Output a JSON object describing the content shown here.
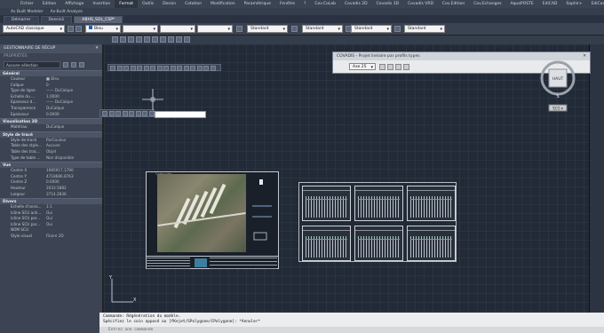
{
  "menubar": {
    "items": [
      "Fichier",
      "Edition",
      "Affichage",
      "Insertion",
      "Format",
      "Outils",
      "Dessin",
      "Cotation",
      "Modification",
      "Paramétrique",
      "Fenêtre",
      "?",
      "Cov.CoLab",
      "Covadis 2D",
      "Covadis 3D",
      "Covadis VRD",
      "Cov.Edition",
      "Cov.Echanges",
      "AquaPOSTE",
      "EdiCAD",
      "Saphir+",
      "EdiCad Light"
    ],
    "active_index": 4
  },
  "subrow": {
    "items": [
      "As Built Modeler",
      "As-Built Analyse"
    ]
  },
  "tabs": {
    "items": [
      "Démarrer",
      "Dessin1",
      "ABHS_SOL_CSP*"
    ],
    "active_index": 2
  },
  "toolbar": {
    "workspace": "AutoCAD classique",
    "color": "Bleu",
    "style1": "Standard",
    "style2": "Standard",
    "style3": "Standard",
    "style4": "Standard"
  },
  "palette": {
    "header": "GESTIONNAIRE DE RÉCUP",
    "close": "✕",
    "side_label": "PROPRIÉTÉS",
    "selection": "Aucune sélection",
    "sections": [
      {
        "title": "Général",
        "rows": [
          {
            "k": "Couleur",
            "v": "■ Bleu"
          },
          {
            "k": "Calque",
            "v": "0"
          },
          {
            "k": "Type de ligne",
            "v": "—— DuCalque"
          },
          {
            "k": "Echelle du ...",
            "v": "1.0000"
          },
          {
            "k": "Epaisseur d...",
            "v": "—— DuCalque"
          },
          {
            "k": "Transparence",
            "v": "DuCalque"
          },
          {
            "k": "Epaisseur",
            "v": "0.0000"
          }
        ]
      },
      {
        "title": "Visualisation 3D",
        "rows": [
          {
            "k": "Matériau",
            "v": "DuCalque"
          }
        ]
      },
      {
        "title": "Style de tracé",
        "rows": [
          {
            "k": "Style de tracé",
            "v": "ParCouleur"
          },
          {
            "k": "Table des style...",
            "v": "Aucune"
          },
          {
            "k": "Table des trac...",
            "v": "Objet"
          },
          {
            "k": "Type de table ...",
            "v": "Non disponible"
          }
        ]
      },
      {
        "title": "Vue",
        "rows": [
          {
            "k": "Centre X",
            "v": "1985917.1790"
          },
          {
            "k": "Centre Y",
            "v": "4718686.8763"
          },
          {
            "k": "Centre Z",
            "v": "0.0000"
          },
          {
            "k": "Hauteur",
            "v": "2033.5882"
          },
          {
            "k": "Largeur",
            "v": "3714.2836"
          }
        ]
      },
      {
        "title": "Divers",
        "rows": [
          {
            "k": "Echelle d'anno...",
            "v": "1:1"
          },
          {
            "k": "Icône SCU acti...",
            "v": "Oui"
          },
          {
            "k": "Icône SCU par...",
            "v": "Oui"
          },
          {
            "k": "Icône SCU par...",
            "v": "Oui"
          },
          {
            "k": "NOM SCU",
            "v": ""
          },
          {
            "k": "Style visuel",
            "v": "Filaire 2D"
          }
        ]
      }
    ]
  },
  "covadis": {
    "title": "COVADIS - Projet linéaire par profils types",
    "close": "✕",
    "select": "Axe 25"
  },
  "viewcube": {
    "top": "HAUT",
    "south": "S",
    "wcs": "SCG ▾"
  },
  "command": {
    "line1": "Commande: Régénération du modèle.",
    "line2": "Spécifiez le coin opposé ou [fKejet/SPolygone/CPolygone]: *Annuler*",
    "placeholder": "Entrez une commande"
  },
  "layout": {
    "sheet_label": "Cartouche"
  },
  "ucs": {
    "x": "X",
    "y": "Y"
  },
  "colors": {
    "accent": "#1f5fbf",
    "canvas": "#212a36",
    "menubar": "#3b4453",
    "ground_line": "#3bbf5e"
  }
}
